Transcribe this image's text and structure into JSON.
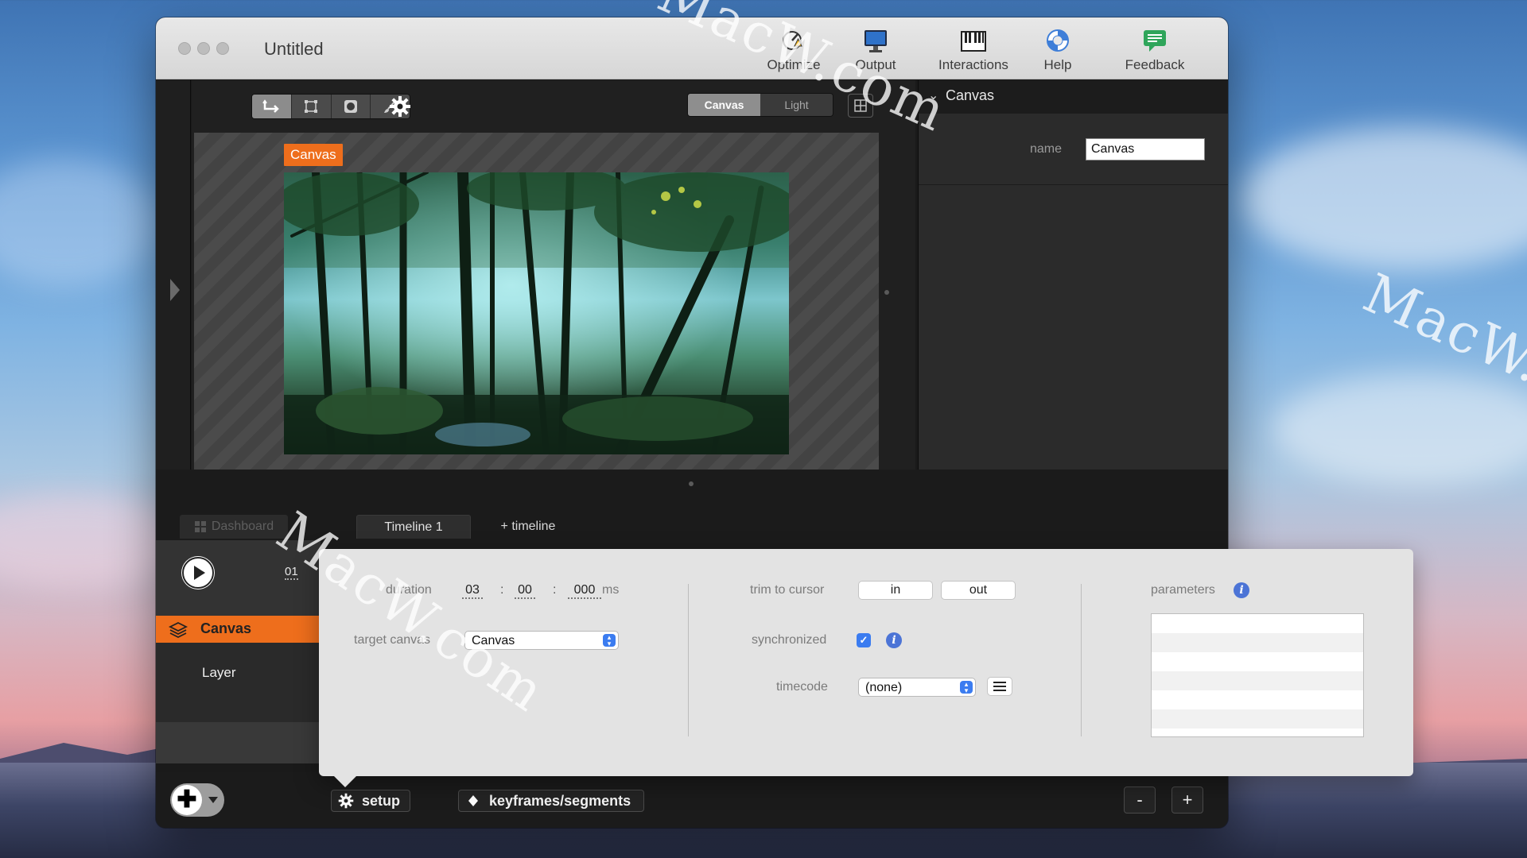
{
  "window": {
    "title": "Untitled"
  },
  "toolbar": [
    {
      "label": "Optimize",
      "icon": "optimize-icon"
    },
    {
      "label": "Output",
      "icon": "monitor-icon"
    },
    {
      "label": "Interactions",
      "icon": "keyboard-icon"
    },
    {
      "label": "Help",
      "icon": "lifebuoy-icon"
    },
    {
      "label": "Feedback",
      "icon": "chat-icon"
    }
  ],
  "viewer": {
    "tools": [
      "select-icon",
      "transform-icon",
      "mask-icon",
      "brush-icon"
    ],
    "mode_toggle": {
      "options": [
        "Canvas",
        "Light"
      ],
      "selected": "Canvas"
    },
    "canvas_tag": "Canvas"
  },
  "inspector": {
    "section_title": "Canvas",
    "name_label": "name",
    "name_value": "Canvas"
  },
  "tabs": {
    "dashboard": "Dashboard",
    "timeline": "Timeline 1",
    "add_timeline": "+ timeline"
  },
  "timeline": {
    "time_field": "01",
    "canvas_row": "Canvas",
    "layer_row": "Layer"
  },
  "setup_panel": {
    "duration_label": "duration",
    "duration": {
      "seconds": "03",
      "frames": "00",
      "ms": "000",
      "unit": "ms"
    },
    "target_canvas_label": "target canvas",
    "target_canvas_value": "Canvas",
    "trim_label": "trim to cursor",
    "trim_in": "in",
    "trim_out": "out",
    "synchronized_label": "synchronized",
    "synchronized": true,
    "timecode_label": "timecode",
    "timecode_value": "(none)",
    "parameters_label": "parameters"
  },
  "bottombar": {
    "setup_label": "setup",
    "keyframes_label": "keyframes/segments",
    "zoom_out": "-",
    "zoom_in": "+"
  },
  "watermarks": [
    "MacW.com",
    "MacW.com",
    "MacW.c"
  ],
  "colors": {
    "accent_orange": "#ee6e1c",
    "checkbox_blue": "#3b7cf0",
    "info_blue": "#4c74d6"
  }
}
